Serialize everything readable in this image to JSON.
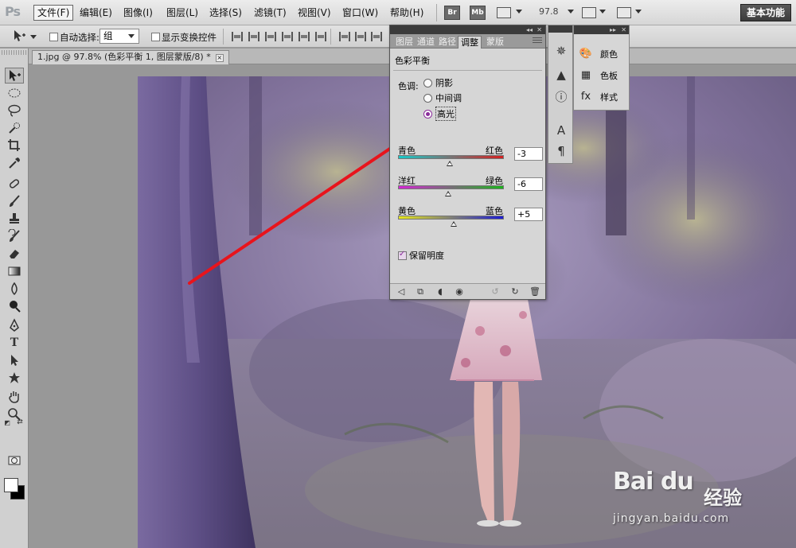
{
  "app": {
    "logo": "Ps"
  },
  "menubar": {
    "items": [
      "文件(F)",
      "编辑(E)",
      "图像(I)",
      "图层(L)",
      "选择(S)",
      "滤镜(T)",
      "视图(V)",
      "窗口(W)",
      "帮助(H)"
    ],
    "bridge_buttons": [
      "Br",
      "Mb"
    ],
    "zoom_value": "97.8",
    "workspace_label": "基本功能"
  },
  "options": {
    "auto_select_label": "自动选择:",
    "auto_select_value": "组",
    "show_transform_label": "显示变换控件"
  },
  "document": {
    "tab_title": "1.jpg @ 97.8% (色彩平衡 1, 图层蒙版/8) *",
    "close_glyph": "×"
  },
  "adjustments": {
    "tabs": [
      "图层",
      "通道",
      "路径",
      "调整",
      "蒙版"
    ],
    "active_tab": "调整",
    "title": "色彩平衡",
    "tone_label": "色调:",
    "tones": [
      "阴影",
      "中间调",
      "高光"
    ],
    "selected_tone": "高光",
    "sliders": [
      {
        "left": "青色",
        "right": "红色",
        "value": "-3",
        "level": -3,
        "colors": [
          "#17c8c8",
          "#d42020"
        ]
      },
      {
        "left": "洋红",
        "right": "绿色",
        "value": "-6",
        "level": -6,
        "colors": [
          "#d426d4",
          "#1cb41c"
        ]
      },
      {
        "left": "黄色",
        "right": "蓝色",
        "value": "+5",
        "level": 5,
        "colors": [
          "#e6e61a",
          "#1c1cd4"
        ]
      }
    ],
    "preserve_label": "保留明度",
    "preserve_checked": true
  },
  "side_panel": {
    "items": [
      {
        "label": "颜色",
        "icon": "palette-icon"
      },
      {
        "label": "色板",
        "icon": "swatches-icon"
      },
      {
        "label": "样式",
        "icon": "styles-icon"
      }
    ]
  },
  "watermark": {
    "brand": "Bai  du",
    "cn": "经验",
    "url": "jingyan.baidu.com"
  },
  "colors": {
    "accent": "#8a2c9a",
    "arrow": "#e8141c"
  }
}
